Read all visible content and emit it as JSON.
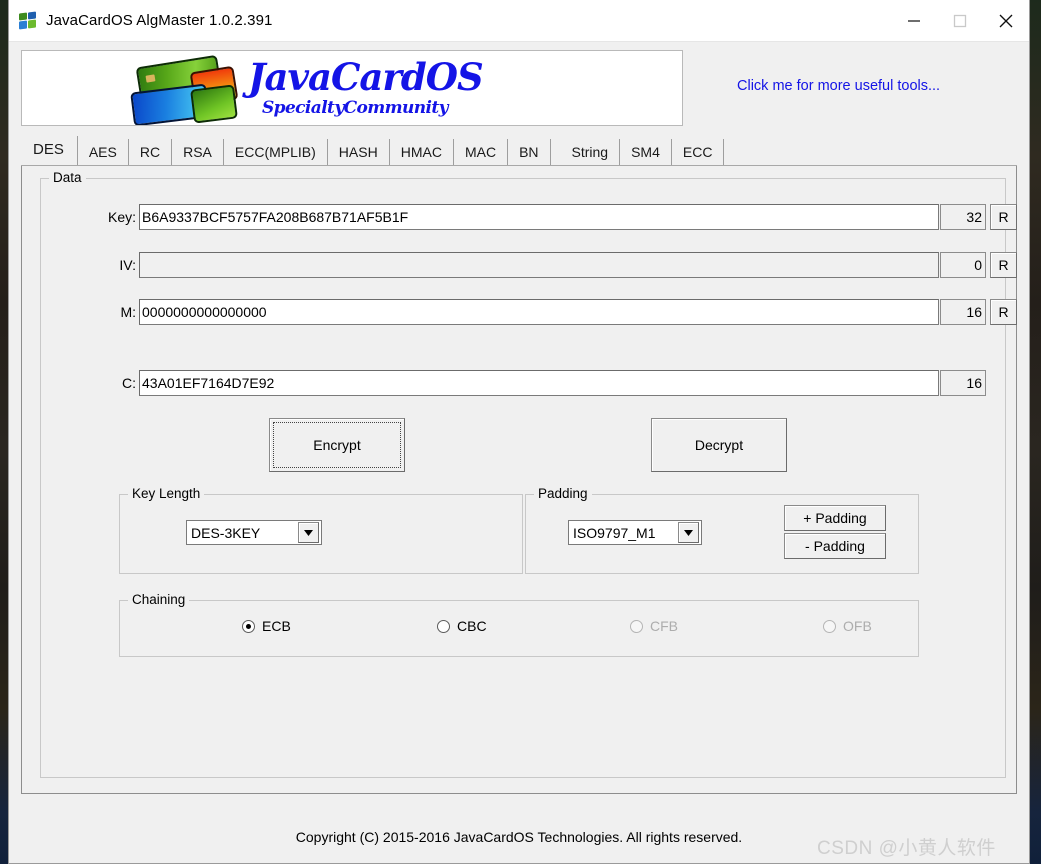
{
  "window": {
    "title": "JavaCardOS AlgMaster 1.0.2.391",
    "minimize_label": "minimize",
    "maximize_label": "maximize",
    "close_label": "close"
  },
  "banner": {
    "logo_word": "JavaCardOS",
    "logo_sub": "SpecialtyCommunity",
    "tools_link": "Click me for more useful tools..."
  },
  "tabs": [
    {
      "label": "DES",
      "selected": true
    },
    {
      "label": "AES",
      "selected": false
    },
    {
      "label": "RC",
      "selected": false
    },
    {
      "label": "RSA",
      "selected": false
    },
    {
      "label": "ECC(MPLIB)",
      "selected": false
    },
    {
      "label": "HASH",
      "selected": false
    },
    {
      "label": "HMAC",
      "selected": false
    },
    {
      "label": "MAC",
      "selected": false
    },
    {
      "label": "BN",
      "selected": false
    },
    {
      "label": "String",
      "selected": false
    },
    {
      "label": "SM4",
      "selected": false
    },
    {
      "label": "ECC",
      "selected": false
    }
  ],
  "data_group": {
    "title": "Data",
    "fields": {
      "key": {
        "label": "Key:",
        "value": "B6A9337BCF5757FA208B687B71AF5B1F",
        "length": "32",
        "random_button": "R"
      },
      "iv": {
        "label": "IV:",
        "value": "",
        "length": "0",
        "random_button": "R"
      },
      "m": {
        "label": "M:",
        "value": "0000000000000000",
        "length": "16",
        "random_button": "R"
      },
      "c": {
        "label": "C:",
        "value": "43A01EF7164D7E92",
        "length": "16"
      }
    },
    "encrypt_button": "Encrypt",
    "decrypt_button": "Decrypt"
  },
  "key_length_group": {
    "title": "Key Length",
    "selected": "DES-3KEY"
  },
  "padding_group": {
    "title": "Padding",
    "selected": "ISO9797_M1",
    "add_button": "+ Padding",
    "remove_button": "- Padding"
  },
  "chaining_group": {
    "title": "Chaining",
    "options": [
      {
        "label": "ECB",
        "checked": true,
        "enabled": true
      },
      {
        "label": "CBC",
        "checked": false,
        "enabled": true
      },
      {
        "label": "CFB",
        "checked": false,
        "enabled": false
      },
      {
        "label": "OFB",
        "checked": false,
        "enabled": false
      }
    ]
  },
  "footer": {
    "copyright": "Copyright (C) 2015-2016 JavaCardOS Technologies. All rights reserved.",
    "watermark": "CSDN @小黄人软件"
  },
  "colors": {
    "link": "#1414e6",
    "window_bg": "#f0f0f0",
    "logo_blue": "#1414e6"
  }
}
